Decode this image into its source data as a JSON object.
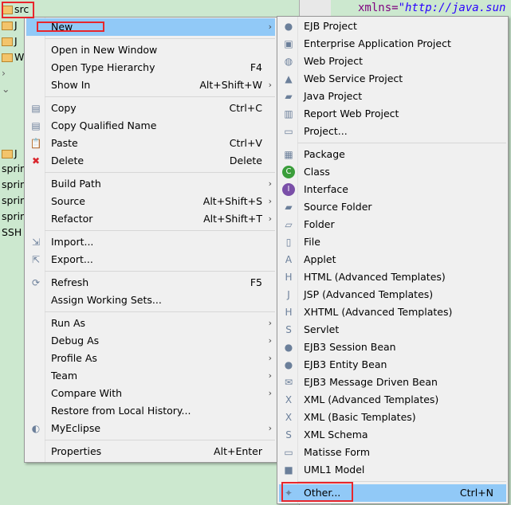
{
  "tree": {
    "rows": [
      {
        "label": "src",
        "icon": "package-folder-icon"
      },
      {
        "label": "J",
        "icon": "library-icon"
      },
      {
        "label": "J",
        "icon": "library-icon"
      },
      {
        "label": "W",
        "icon": "web-folder-icon"
      },
      {
        "label": "",
        "icon": "chevron-right-icon"
      },
      {
        "label": "",
        "icon": "chevron-down-icon"
      },
      {
        "label": "J",
        "icon": "jsp-file-icon"
      },
      {
        "label": "sprin",
        "icon": ""
      },
      {
        "label": "sprin",
        "icon": ""
      },
      {
        "label": "sprin",
        "icon": ""
      },
      {
        "label": "sprin",
        "icon": ""
      },
      {
        "label": "SSH",
        "icon": ""
      }
    ]
  },
  "editor": {
    "code_attr": "xmlns=",
    "code_value": "\"http://java.sun"
  },
  "context_menu": {
    "items": [
      {
        "label": "New",
        "submenu": true,
        "highlighted": true
      },
      {
        "sep": true
      },
      {
        "label": "Open in New Window"
      },
      {
        "label": "Open Type Hierarchy",
        "shortcut": "F4"
      },
      {
        "label": "Show In",
        "shortcut": "Alt+Shift+W",
        "submenu": true
      },
      {
        "sep": true
      },
      {
        "label": "Copy",
        "shortcut": "Ctrl+C",
        "icon": "copy-icon"
      },
      {
        "label": "Copy Qualified Name",
        "icon": "copy-qualified-name-icon"
      },
      {
        "label": "Paste",
        "shortcut": "Ctrl+V",
        "icon": "paste-icon"
      },
      {
        "label": "Delete",
        "shortcut": "Delete",
        "icon": "delete-icon"
      },
      {
        "sep": true
      },
      {
        "label": "Build Path",
        "submenu": true
      },
      {
        "label": "Source",
        "shortcut": "Alt+Shift+S",
        "submenu": true
      },
      {
        "label": "Refactor",
        "shortcut": "Alt+Shift+T",
        "submenu": true
      },
      {
        "sep": true
      },
      {
        "label": "Import...",
        "icon": "import-icon"
      },
      {
        "label": "Export...",
        "icon": "export-icon"
      },
      {
        "sep": true
      },
      {
        "label": "Refresh",
        "shortcut": "F5",
        "icon": "refresh-icon"
      },
      {
        "label": "Assign Working Sets..."
      },
      {
        "sep": true
      },
      {
        "label": "Run As",
        "submenu": true
      },
      {
        "label": "Debug As",
        "submenu": true
      },
      {
        "label": "Profile As",
        "submenu": true
      },
      {
        "label": "Team",
        "submenu": true
      },
      {
        "label": "Compare With",
        "submenu": true
      },
      {
        "label": "Restore from Local History..."
      },
      {
        "label": "MyEclipse",
        "submenu": true,
        "icon": "myeclipse-icon"
      },
      {
        "sep": true
      },
      {
        "label": "Properties",
        "shortcut": "Alt+Enter"
      }
    ]
  },
  "new_submenu": {
    "items": [
      {
        "label": "EJB Project",
        "icon": "ejb-project-icon"
      },
      {
        "label": "Enterprise Application Project",
        "icon": "enterprise-project-icon"
      },
      {
        "label": "Web Project",
        "icon": "web-project-icon"
      },
      {
        "label": "Web Service Project",
        "icon": "web-service-project-icon"
      },
      {
        "label": "Java Project",
        "icon": "java-project-icon"
      },
      {
        "label": "Report Web Project",
        "icon": "report-project-icon"
      },
      {
        "label": "Project...",
        "icon": "project-icon"
      },
      {
        "sep": true
      },
      {
        "label": "Package",
        "icon": "package-icon"
      },
      {
        "label": "Class",
        "icon": "class-icon"
      },
      {
        "label": "Interface",
        "icon": "interface-icon"
      },
      {
        "label": "Source Folder",
        "icon": "source-folder-icon"
      },
      {
        "label": "Folder",
        "icon": "folder-icon"
      },
      {
        "label": "File",
        "icon": "file-icon"
      },
      {
        "label": "Applet",
        "icon": "applet-icon"
      },
      {
        "label": "HTML (Advanced Templates)",
        "icon": "html-icon"
      },
      {
        "label": "JSP (Advanced Templates)",
        "icon": "jsp-icon"
      },
      {
        "label": "XHTML (Advanced Templates)",
        "icon": "xhtml-icon"
      },
      {
        "label": "Servlet",
        "icon": "servlet-icon"
      },
      {
        "label": "EJB3 Session Bean",
        "icon": "session-bean-icon"
      },
      {
        "label": "EJB3 Entity Bean",
        "icon": "entity-bean-icon"
      },
      {
        "label": "EJB3 Message Driven Bean",
        "icon": "message-bean-icon"
      },
      {
        "label": "XML (Advanced Templates)",
        "icon": "xml-icon"
      },
      {
        "label": "XML (Basic Templates)",
        "icon": "xml-icon"
      },
      {
        "label": "XML Schema",
        "icon": "xml-schema-icon"
      },
      {
        "label": "Matisse Form",
        "icon": "matisse-form-icon"
      },
      {
        "label": "UML1 Model",
        "icon": "uml-model-icon"
      },
      {
        "sep": true
      },
      {
        "label": "Other...",
        "shortcut": "Ctrl+N",
        "icon": "other-wizard-icon",
        "highlighted": true
      }
    ]
  },
  "icon_glyphs": {
    "copy-icon": "▤",
    "copy-qualified-name-icon": "▤",
    "paste-icon": "📋",
    "delete-icon": "✖",
    "import-icon": "⇲",
    "export-icon": "⇱",
    "refresh-icon": "⟳",
    "myeclipse-icon": "◐",
    "ejb-project-icon": "●",
    "enterprise-project-icon": "▣",
    "web-project-icon": "◍",
    "web-service-project-icon": "▲",
    "java-project-icon": "▰",
    "report-project-icon": "▥",
    "project-icon": "▭",
    "package-icon": "▦",
    "class-icon": "C",
    "interface-icon": "I",
    "source-folder-icon": "▰",
    "folder-icon": "▱",
    "file-icon": "▯",
    "applet-icon": "A",
    "html-icon": "H",
    "jsp-icon": "J",
    "xhtml-icon": "H",
    "servlet-icon": "S",
    "session-bean-icon": "●",
    "entity-bean-icon": "●",
    "message-bean-icon": "✉",
    "xml-icon": "X",
    "xml-schema-icon": "S",
    "matisse-form-icon": "▭",
    "uml-model-icon": "■",
    "other-wizard-icon": "✦"
  },
  "colors": {
    "highlight": "#91c9f7",
    "annotation": "#e8262c",
    "delete": "#d9272e",
    "class": "#3a9d3a",
    "interface": "#7a4fa8"
  }
}
